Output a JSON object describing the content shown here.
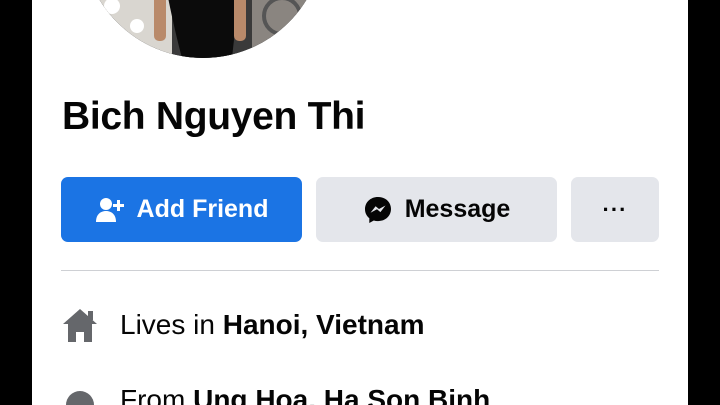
{
  "profile": {
    "name": "Bich Nguyen Thi"
  },
  "actions": {
    "add_friend_label": "Add Friend",
    "message_label": "Message",
    "more_label": "···"
  },
  "intro": {
    "lives_prefix": "Lives in ",
    "lives_place": "Hanoi, Vietnam",
    "from_prefix": "From ",
    "from_place": "Ung Hoa, Ha Son Binh"
  },
  "colors": {
    "accent": "#1b74e4",
    "secondary_button": "#e4e6eb",
    "icon_gray": "#65676b"
  },
  "icons": {
    "add_friend": "person-plus-icon",
    "message": "messenger-icon",
    "lives_in": "home-icon",
    "from": "location-icon"
  }
}
